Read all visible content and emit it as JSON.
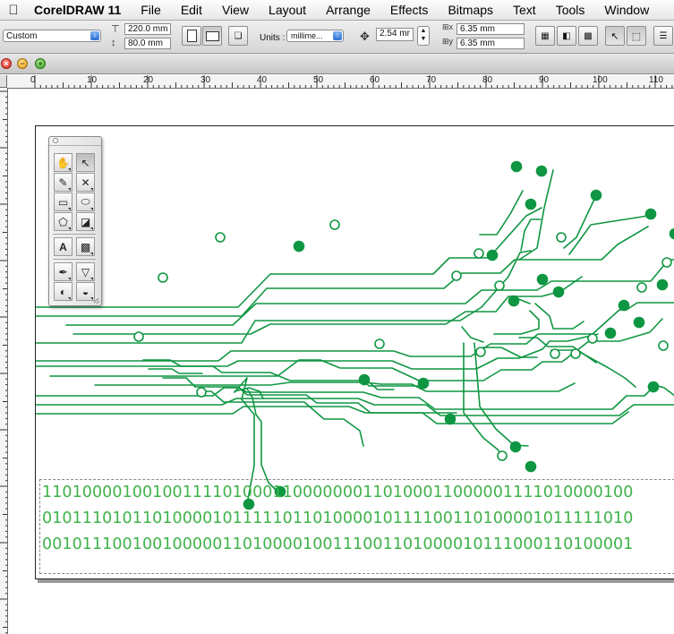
{
  "menubar": {
    "app_name": "CorelDRAW 11",
    "items": [
      "File",
      "Edit",
      "View",
      "Layout",
      "Arrange",
      "Effects",
      "Bitmaps",
      "Text",
      "Tools",
      "Window"
    ]
  },
  "property_bar": {
    "paper_preset": "Custom",
    "width_value": "220.0 mm",
    "height_value": "80.0 mm",
    "units_label": "Units :",
    "units_value": "millime...",
    "nudge_value": "2.54 mr",
    "dup_x_value": "6.35 mm",
    "dup_y_value": "6.35 mm"
  },
  "ruler": {
    "marks": [
      "0",
      "10",
      "20",
      "30",
      "40",
      "50",
      "60",
      "70",
      "80",
      "90",
      "100",
      "110"
    ]
  },
  "document": {
    "binary_lines": [
      "11010000100100111101000110000000110100011000001111010000100",
      "01011101011010000101111101101000010111100110100001011111010",
      "00101110010010000011010000100111001101000010111000110100001"
    ]
  },
  "colors": {
    "trace_green": "#0f9642",
    "text_green": "#3fb24a"
  }
}
